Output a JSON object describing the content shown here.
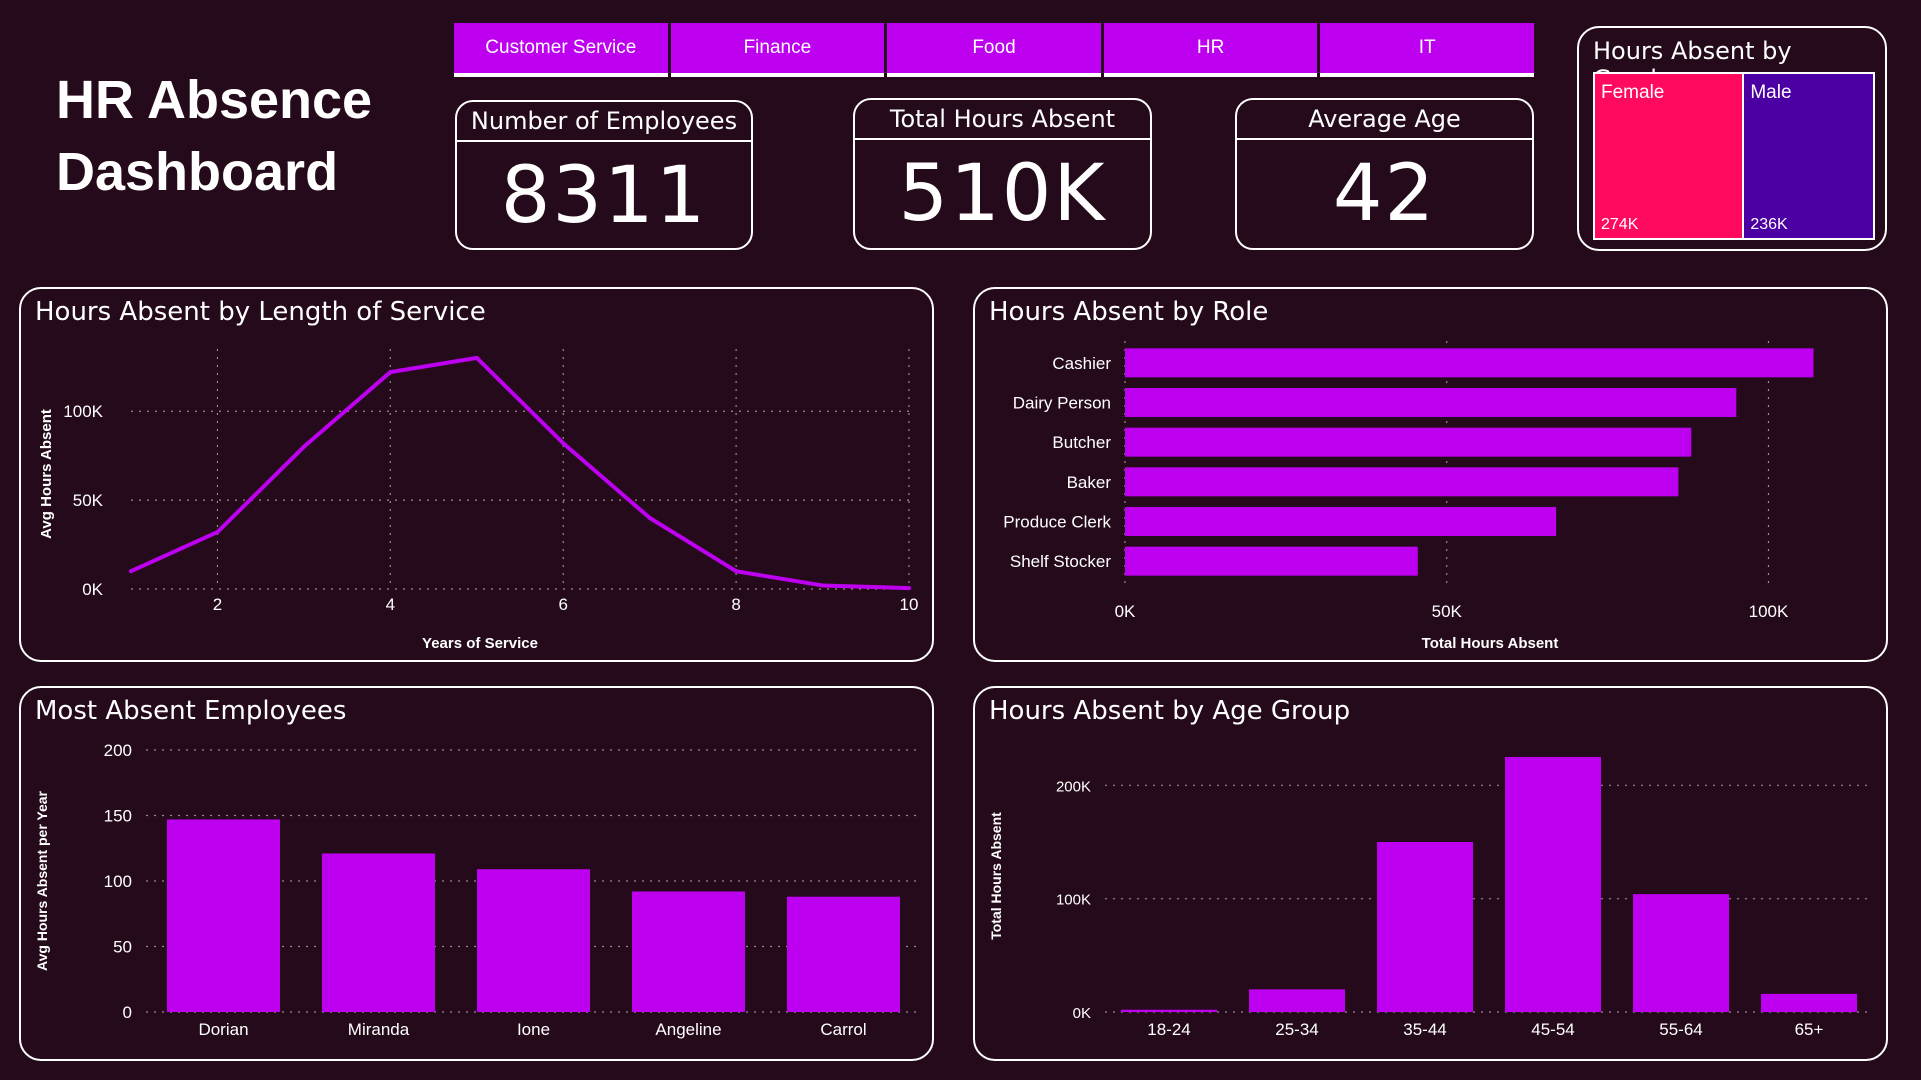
{
  "title": "HR Absence\nDashboard",
  "accent": "#be00f0",
  "background": "#240a1a",
  "departments": [
    "Customer Service",
    "Finance",
    "Food",
    "HR",
    "IT"
  ],
  "kpis": {
    "employees": {
      "label": "Number of Employees",
      "value": "8311"
    },
    "hours": {
      "label": "Total Hours Absent",
      "value": "510K"
    },
    "age": {
      "label": "Average Age",
      "value": "42"
    }
  },
  "gender": {
    "title": "Hours Absent by Gender",
    "items": [
      {
        "label": "Female",
        "value": "274K",
        "raw": 274,
        "color": "#ff0a5f"
      },
      {
        "label": "Male",
        "value": "236K",
        "raw": 236,
        "color": "#4c00a4"
      }
    ]
  },
  "chart_data": [
    {
      "id": "service",
      "type": "line",
      "title": "Hours Absent by Length of Service",
      "xlabel": "Years of Service",
      "ylabel": "Avg Hours Absent",
      "x": [
        1,
        2,
        3,
        4,
        5,
        6,
        7,
        8,
        9,
        10
      ],
      "y": [
        10000,
        32000,
        80000,
        122000,
        130000,
        82000,
        40000,
        10000,
        2000,
        500
      ],
      "xticks": [
        2,
        4,
        6,
        8,
        10
      ],
      "yticks": [
        0,
        50000,
        100000
      ],
      "ytick_labels": [
        "0K",
        "50K",
        "100K"
      ],
      "xlim": [
        1,
        10
      ],
      "ylim": [
        0,
        135000
      ],
      "grid": true
    },
    {
      "id": "role",
      "type": "bar",
      "orientation": "horizontal",
      "title": "Hours Absent by Role",
      "xlabel": "Total Hours Absent",
      "ylabel": "",
      "categories": [
        "Cashier",
        "Dairy Person",
        "Butcher",
        "Baker",
        "Produce Clerk",
        "Shelf Stocker"
      ],
      "values": [
        107000,
        95000,
        88000,
        86000,
        67000,
        45500
      ],
      "xticks": [
        0,
        50000,
        100000
      ],
      "xtick_labels": [
        "0K",
        "50K",
        "100K"
      ],
      "xlim": [
        0,
        115000
      ],
      "grid": true
    },
    {
      "id": "employees",
      "type": "bar",
      "title": "Most Absent Employees",
      "xlabel": "",
      "ylabel": "Avg Hours Absent per Year",
      "categories": [
        "Dorian",
        "Miranda",
        "Ione",
        "Angeline",
        "Carrol"
      ],
      "values": [
        147,
        121,
        109,
        92,
        88
      ],
      "yticks": [
        0,
        50,
        100,
        150,
        200
      ],
      "ytick_labels": [
        "0",
        "50",
        "100",
        "150",
        "200"
      ],
      "ylim": [
        0,
        200
      ],
      "grid": true
    },
    {
      "id": "age",
      "type": "bar",
      "title": "Hours Absent by Age Group",
      "xlabel": "",
      "ylabel": "Total Hours Absent",
      "categories": [
        "18-24",
        "25-34",
        "35-44",
        "45-54",
        "55-64",
        "65+"
      ],
      "values": [
        2000,
        20000,
        150000,
        225000,
        104000,
        16000
      ],
      "yticks": [
        0,
        100000,
        200000
      ],
      "ytick_labels": [
        "0K",
        "100K",
        "200K"
      ],
      "ylim": [
        0,
        240000
      ],
      "grid": true
    }
  ]
}
